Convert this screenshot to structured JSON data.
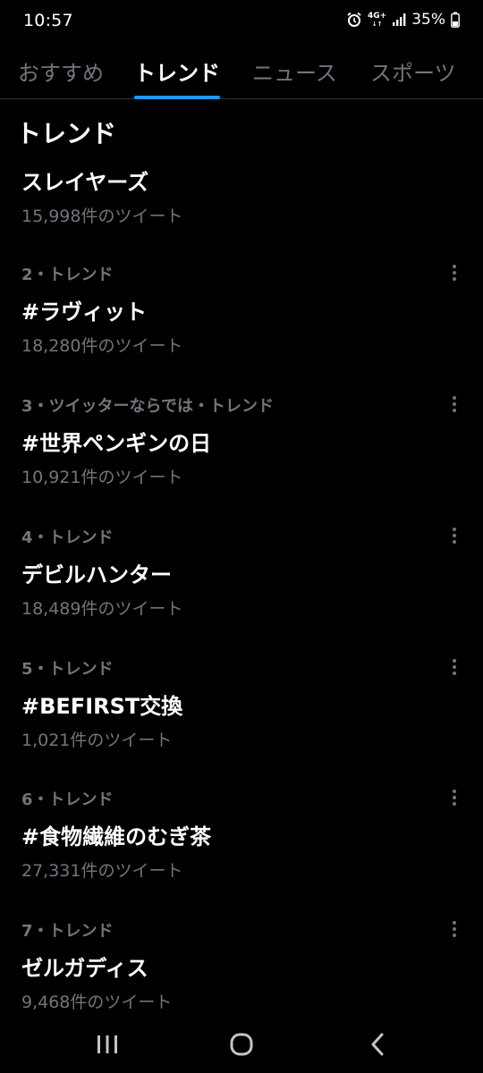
{
  "status_bar": {
    "time": "10:57",
    "network": "4G+",
    "battery": "35%"
  },
  "tabs": [
    {
      "label": "おすすめ",
      "active": false
    },
    {
      "label": "トレンド",
      "active": true
    },
    {
      "label": "ニュース",
      "active": false
    },
    {
      "label": "スポーツ",
      "active": false
    }
  ],
  "section": {
    "title": "トレンド"
  },
  "trends": [
    {
      "meta": "",
      "name": "スレイヤーズ",
      "count": "15,998件のツイート",
      "has_menu": false
    },
    {
      "meta": "2・トレンド",
      "name": "#ラヴィット",
      "count": "18,280件のツイート",
      "has_menu": true
    },
    {
      "meta": "3・ツイッターならでは・トレンド",
      "name": "#世界ペンギンの日",
      "count": "10,921件のツイート",
      "has_menu": true
    },
    {
      "meta": "4・トレンド",
      "name": "デビルハンター",
      "count": "18,489件のツイート",
      "has_menu": true
    },
    {
      "meta": "5・トレンド",
      "name": "#BEFIRST交換",
      "count": "1,021件のツイート",
      "has_menu": true
    },
    {
      "meta": "6・トレンド",
      "name": "#食物繊維のむぎ茶",
      "count": "27,331件のツイート",
      "has_menu": true
    },
    {
      "meta": "7・トレンド",
      "name": "ゼルガディス",
      "count": "9,468件のツイート",
      "has_menu": true
    }
  ],
  "icons": {
    "status": [
      "alarm-icon",
      "signal-icon",
      "battery-icon"
    ],
    "trend_menu": "more-vertical-icon",
    "nav": [
      "recent-apps-icon",
      "home-icon",
      "back-icon"
    ]
  },
  "colors": {
    "background": "#000000",
    "primary_text": "#ffffff",
    "secondary_text": "#71767b",
    "accent": "#1d9bf0",
    "divider": "#2f3336"
  }
}
